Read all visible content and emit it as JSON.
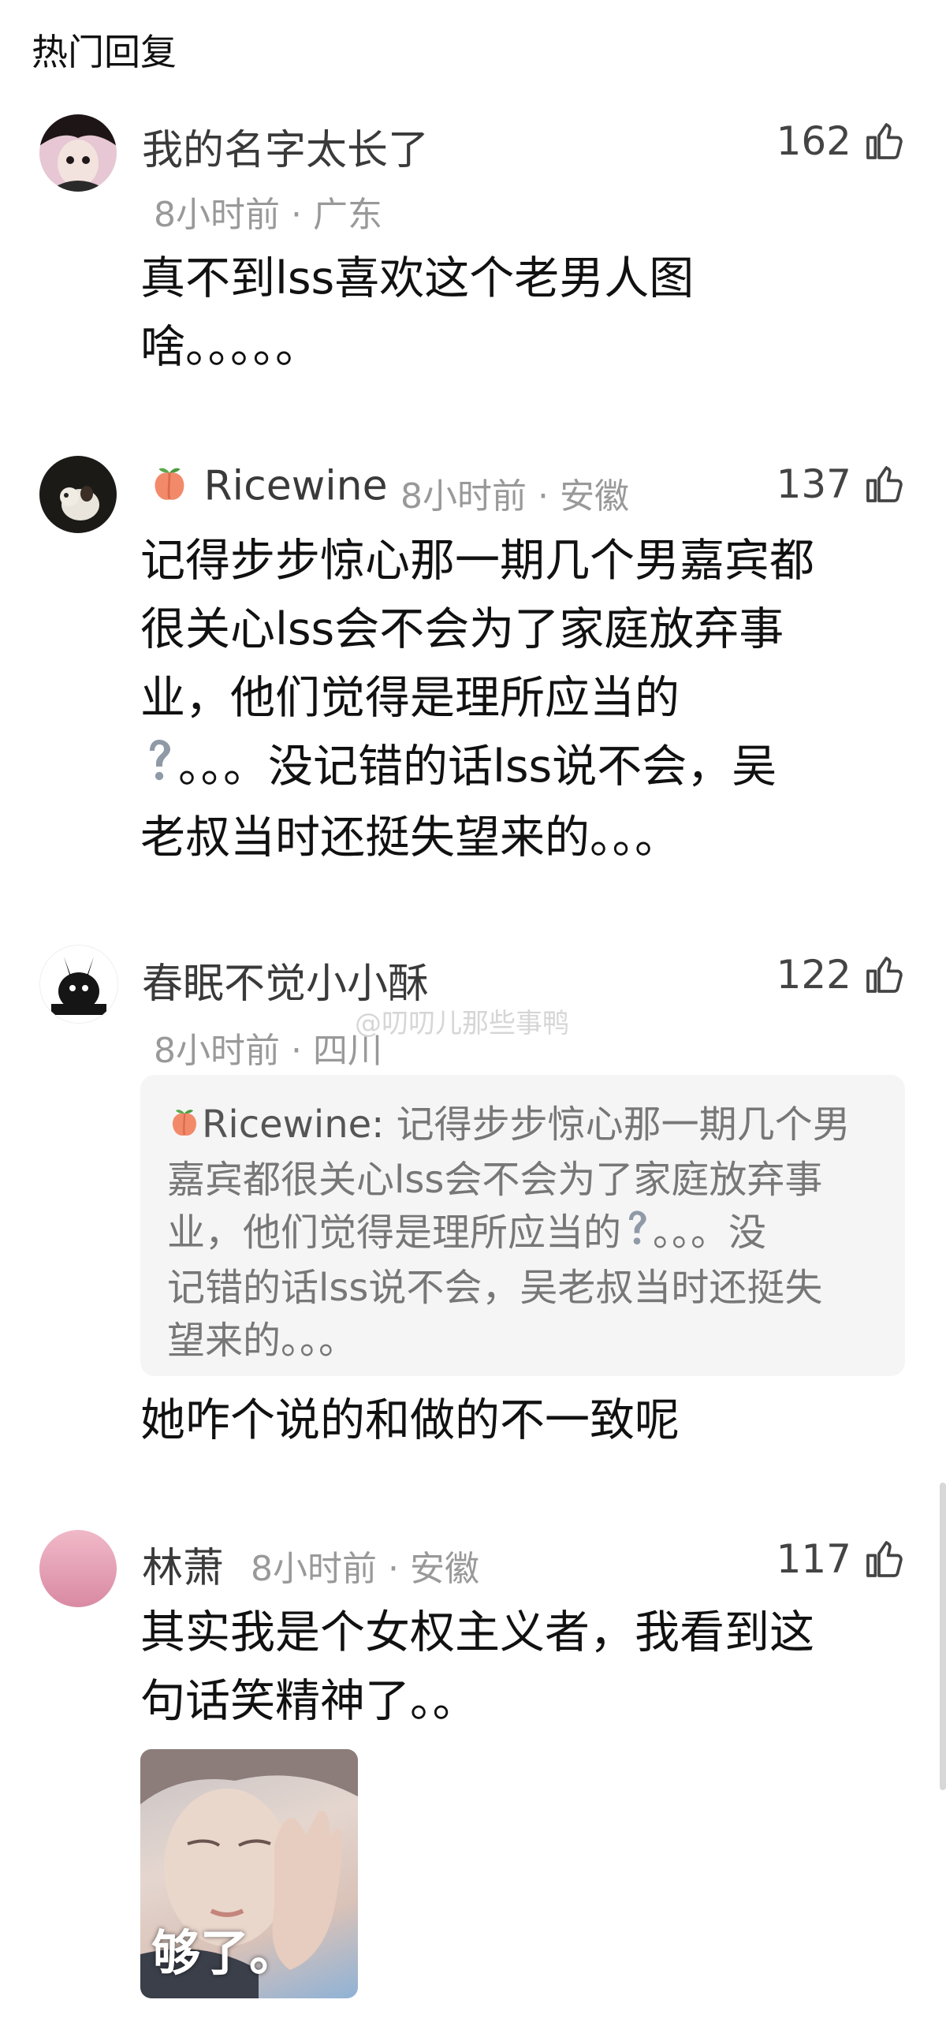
{
  "header": {
    "title": "热门回复"
  },
  "watermark": "@叨叨儿那些事鸭",
  "comments": [
    {
      "username": "我的名字太长了",
      "meta": "8小时前 · 广东",
      "likes": "162",
      "lines": [
        "真不到lss喜欢这个老男人图",
        "啥。。。。。"
      ]
    },
    {
      "username": "Ricewine",
      "meta": "8小时前 · 安徽",
      "likes": "137",
      "lines": [
        "记得步步惊心那一期几个男嘉宾都",
        "很关心lss会不会为了家庭放弃事",
        "业，他们觉得是理所应当的",
        "。。。没记错的话lss说不会，吴",
        "老叔当时还挺失望来的。。。"
      ]
    },
    {
      "username": "春眠不觉小小酥",
      "meta": "8小时前 · 四川",
      "likes": "122",
      "quote": {
        "name": "Ricewine: ",
        "lines": [
          "记得步步惊心那一期几个男",
          "嘉宾都很关心lss会不会为了家庭放弃事",
          "业，他们觉得是理所应当的",
          "。。。没",
          "记错的话lss说不会，吴老叔当时还挺失",
          "望来的。。。"
        ]
      },
      "lines": [
        "她咋个说的和做的不一致呢"
      ]
    },
    {
      "username": "林萧",
      "meta": "8小时前 · 安徽",
      "likes": "117",
      "lines": [
        "其实我是个女权主义者，我看到这",
        "句话笑精神了。。"
      ],
      "image_caption": "够了。"
    }
  ],
  "icons": {
    "like": "thumbs-up-icon",
    "peach": "peach-emoji",
    "question": "question-mark-emoji"
  },
  "colors": {
    "meta": "#999999",
    "quote_bg": "#f5f5f5",
    "text": "#111111"
  }
}
